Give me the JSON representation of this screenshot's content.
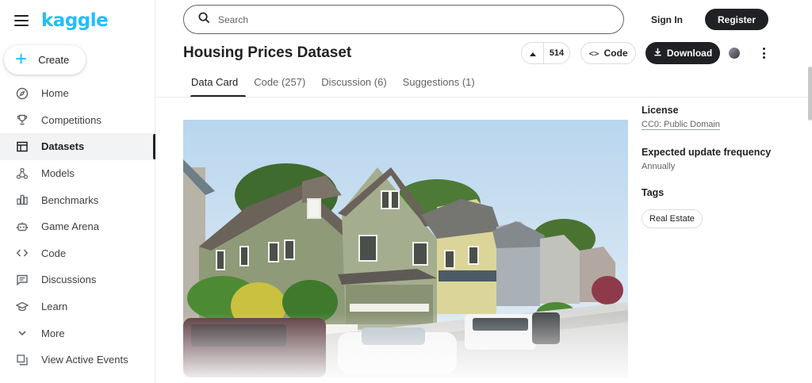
{
  "brand": {
    "logo_text": "kaggle",
    "accent_color": "#20beff"
  },
  "sidebar": {
    "create_label": "Create",
    "items": [
      {
        "label": "Home",
        "icon": "compass-icon"
      },
      {
        "label": "Competitions",
        "icon": "trophy-icon"
      },
      {
        "label": "Datasets",
        "icon": "table-icon",
        "active": true
      },
      {
        "label": "Models",
        "icon": "models-icon"
      },
      {
        "label": "Benchmarks",
        "icon": "bar-chart-icon"
      },
      {
        "label": "Game Arena",
        "icon": "robot-icon"
      },
      {
        "label": "Code",
        "icon": "code-icon"
      },
      {
        "label": "Discussions",
        "icon": "chat-icon"
      },
      {
        "label": "Learn",
        "icon": "graduation-cap-icon"
      },
      {
        "label": "More",
        "icon": "chevron-down-icon"
      },
      {
        "label": "View Active Events",
        "icon": "copy-icon"
      }
    ]
  },
  "header": {
    "search_placeholder": "Search",
    "signin_label": "Sign In",
    "register_label": "Register"
  },
  "dataset": {
    "title": "Housing Prices Dataset",
    "upvotes": "514",
    "code_label": "Code",
    "download_label": "Download",
    "tabs": [
      {
        "label": "Data Card",
        "active": true
      },
      {
        "label": "Code (257)"
      },
      {
        "label": "Discussion (6)"
      },
      {
        "label": "Suggestions (1)"
      }
    ]
  },
  "details": {
    "license_heading": "License",
    "license_value": "CC0: Public Domain",
    "frequency_heading": "Expected update frequency",
    "frequency_value": "Annually",
    "tags_heading": "Tags",
    "tags": [
      "Real Estate"
    ]
  }
}
